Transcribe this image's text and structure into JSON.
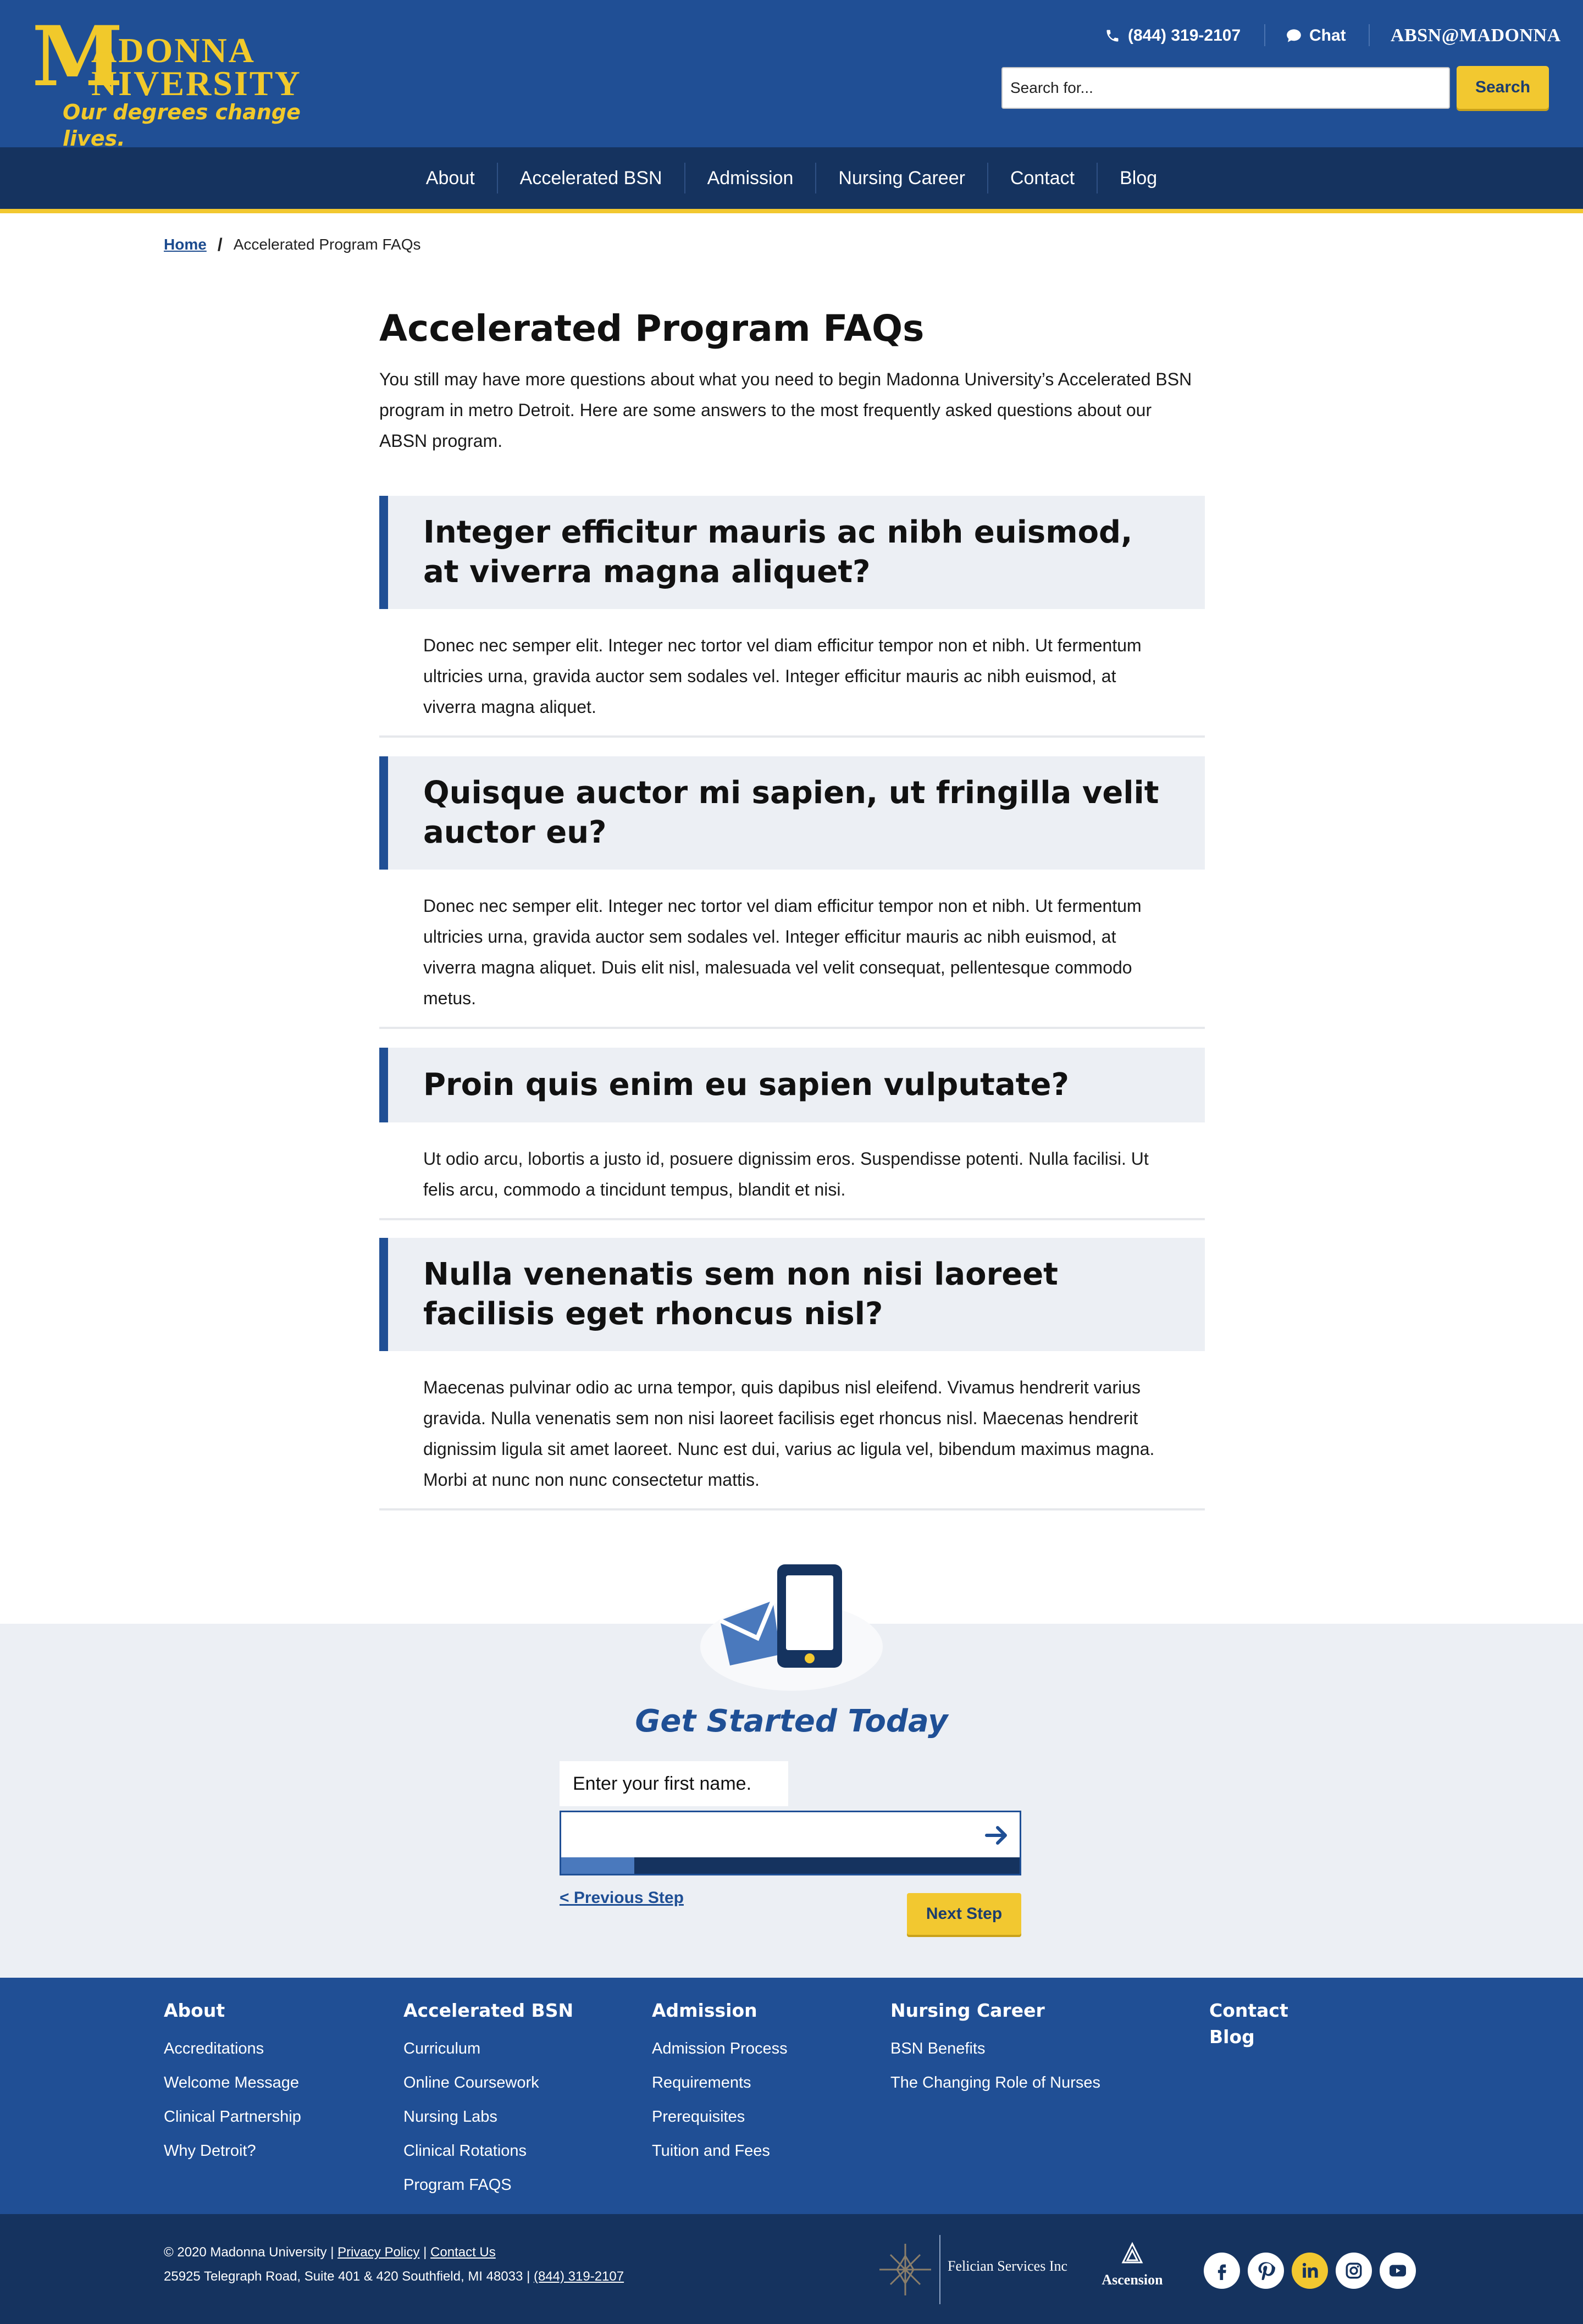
{
  "header": {
    "logo": {
      "m": "M",
      "line1": "ADONNA",
      "line2": "NIVERSITY",
      "tagline": "Our degrees change lives."
    },
    "phone": "(844) 319-2107",
    "chat": "Chat",
    "absn": "ABSN@MADONNA",
    "search": {
      "placeholder": "Search for...",
      "button": "Search"
    }
  },
  "nav": [
    "About",
    "Accelerated BSN",
    "Admission",
    "Nursing Career",
    "Contact",
    "Blog"
  ],
  "breadcrumb": {
    "home": "Home",
    "separator": "/",
    "current": "Accelerated Program FAQs"
  },
  "main": {
    "title": "Accelerated Program FAQs",
    "intro": "You still may have more questions about what you need to begin Madonna University’s Accelerated BSN program in metro Detroit. Here are some answers to the most frequently asked questions about our ABSN program.",
    "faqs": [
      {
        "question": "Integer efficitur mauris ac nibh euismod, at viverra magna aliquet?",
        "answer": "Donec nec semper elit. Integer nec tortor vel diam efficitur tempor non et nibh. Ut fermentum ultricies urna, gravida auctor sem sodales vel. Integer efficitur mauris ac nibh euismod, at viverra magna aliquet."
      },
      {
        "question": "Quisque auctor mi sapien, ut fringilla velit auctor eu?",
        "answer": "Donec nec semper elit. Integer nec tortor vel diam efficitur tempor non et nibh. Ut fermentum ultricies urna, gravida auctor sem sodales vel. Integer efficitur mauris ac nibh euismod, at viverra magna aliquet. Duis elit nisl, malesuada vel velit consequat, pellentesque commodo metus."
      },
      {
        "question": "Proin quis enim eu sapien vulputate?",
        "answer": "Ut odio arcu, lobortis a justo id, posuere dignissim eros. Suspendisse potenti. Nulla facilisi. Ut felis arcu, commodo a tincidunt tempus, blandit et nisi."
      },
      {
        "question": "Nulla venenatis sem non nisi laoreet facilisis eget rhoncus nisl?",
        "answer": "Maecenas pulvinar odio ac urna tempor, quis dapibus nisl eleifend. Vivamus hendrerit varius gravida. Nulla venenatis sem non nisi laoreet facilisis eget rhoncus nisl. Maecenas hendrerit dignissim ligula sit amet laoreet. Nunc est dui, varius ac ligula vel, bibendum maximus magna. Morbi at nunc non nunc consectetur mattis."
      }
    ]
  },
  "cta": {
    "title": "Get Started Today",
    "field_label": "Enter your first name.",
    "field_value": "",
    "progress": 0.16,
    "prev": "< Previous Step",
    "next": "Next Step"
  },
  "footer": {
    "columns": [
      {
        "heading": "About",
        "links": [
          "Accreditations",
          "Welcome Message",
          "Clinical Partnership",
          "Why Detroit?"
        ]
      },
      {
        "heading": "Accelerated BSN",
        "links": [
          "Curriculum",
          "Online Coursework",
          "Nursing Labs",
          "Clinical Rotations",
          "Program FAQS"
        ]
      },
      {
        "heading": "Admission",
        "links": [
          "Admission Process",
          "Requirements",
          "Prerequisites",
          "Tuition and Fees"
        ]
      },
      {
        "heading": "Nursing Career",
        "links": [
          "BSN Benefits",
          "The Changing Role of Nurses"
        ]
      },
      {
        "heading": "Contact",
        "links": []
      },
      {
        "heading": "Blog",
        "links": []
      }
    ],
    "copyright": "© 2020 Madonna University",
    "privacy": "Privacy Policy",
    "contact_us": "Contact Us",
    "separator": "|",
    "address": "25925 Telegraph Road, Suite 401 & 420 Southfield, MI 48033",
    "phone": "(844) 319-2107",
    "felician": "Felician Services Inc",
    "ascension": "Ascension",
    "social_icons": [
      "facebook-icon",
      "pinterest-icon",
      "linkedin-icon",
      "instagram-icon",
      "youtube-icon"
    ]
  },
  "colors": {
    "brand_blue": "#204f95",
    "navy": "#15335f",
    "gold": "#f2c830",
    "panel": "#eceff4"
  }
}
